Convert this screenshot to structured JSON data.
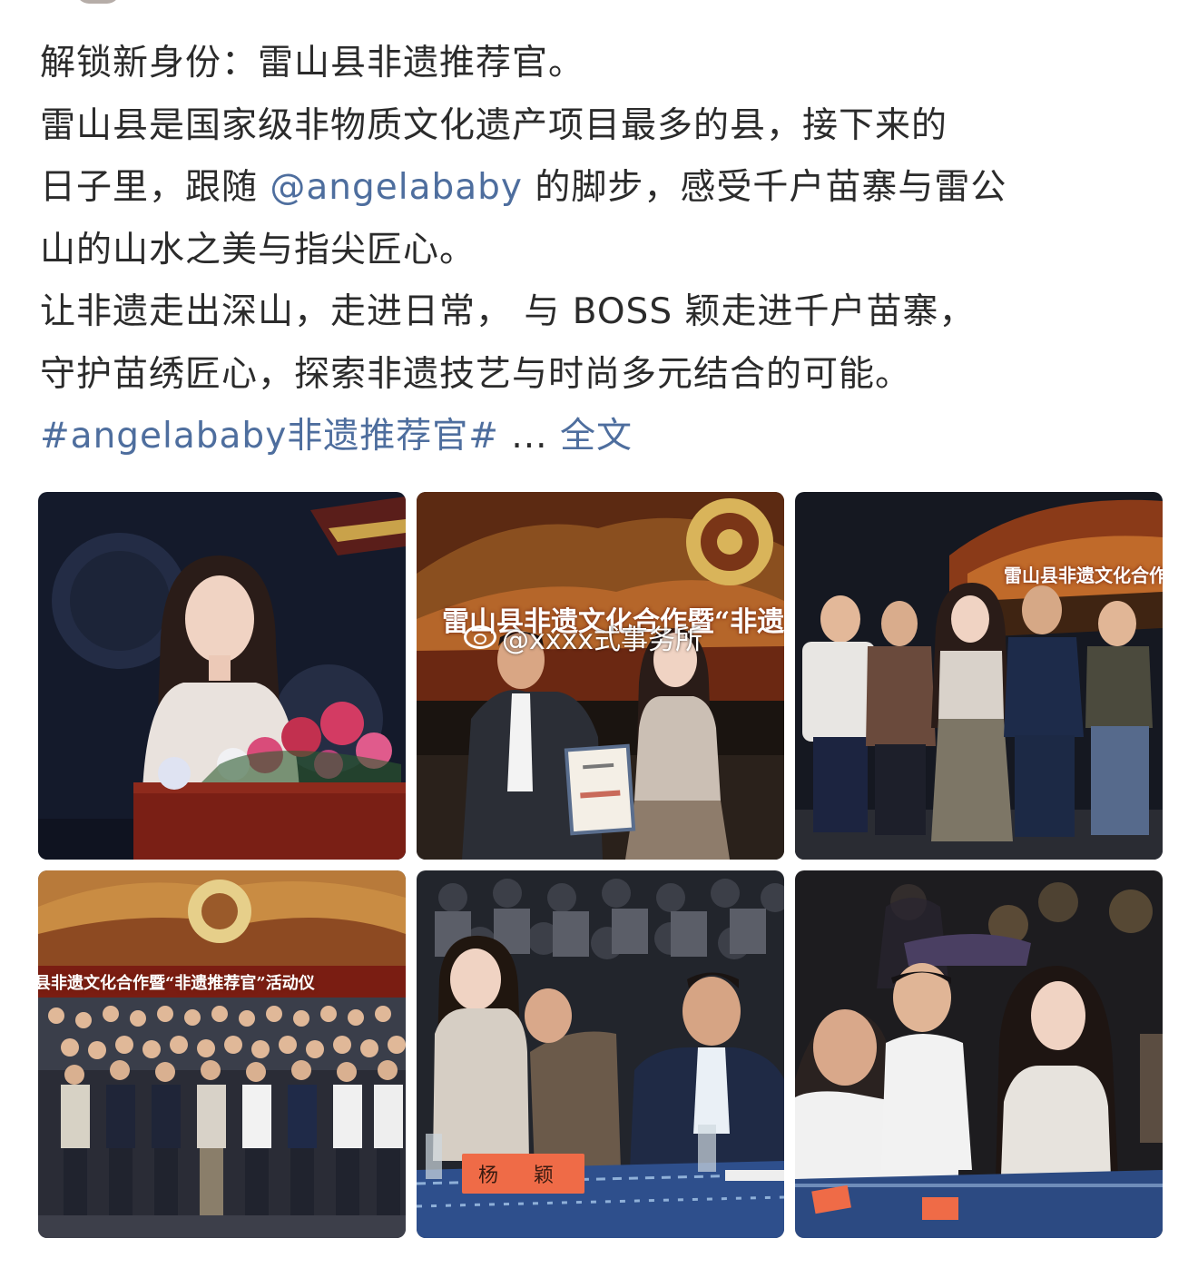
{
  "post": {
    "lines": [
      "解锁新身份：雷山县非遗推荐官。",
      "雷山县是国家级非物质文化遗产项目最多的县，接下来的"
    ],
    "line3_before": "日子里，跟随 ",
    "mention": "@angelababy",
    "line3_after": " 的脚步，感受千户苗寨与雷公",
    "line4": "山的山水之美与指尖匠心。",
    "line5": "让非遗走出深山，走进日常， 与 BOSS 颖走进千户苗寨，",
    "line6": "守护苗绣匠心，探索非遗技艺与时尚多元结合的可能。",
    "hashtag": "#angelababy非遗推荐官#",
    "ellipsis": " ... ",
    "full_text_link": "全文"
  },
  "photos": {
    "watermark": "@xxxx式事务所",
    "banner_2": "雷山县非遗文化合作暨“非遗",
    "banner_3": "雷山县非遗文化合作",
    "banner_4": "县非遗文化合作暨“非遗推荐官”活动仪",
    "nameplate_5": "杨 颖"
  },
  "colors": {
    "link": "#4e6e9e",
    "text": "#2b2b2b",
    "stage_dark": "#1b2236",
    "table_blue": "#2e4f8c"
  }
}
